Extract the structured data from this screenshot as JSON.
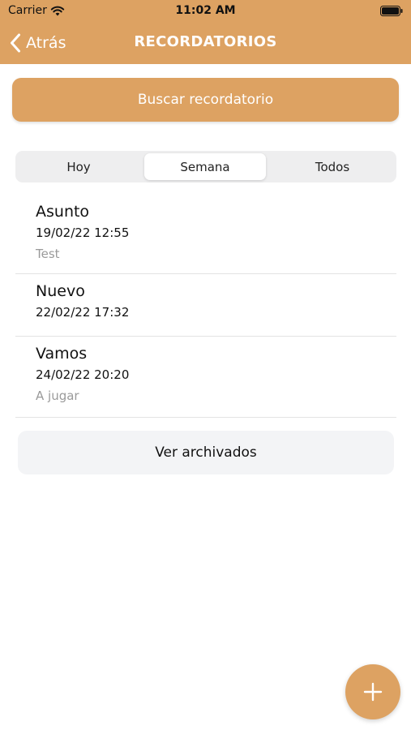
{
  "status_bar": {
    "carrier": "Carrier",
    "time": "11:02 AM",
    "icons": [
      "wifi-icon",
      "battery-icon"
    ]
  },
  "nav": {
    "back_label": "Atrás",
    "title": "RECORDATORIOS"
  },
  "search": {
    "label": "Buscar recordatorio"
  },
  "segments": {
    "items": [
      "Hoy",
      "Semana",
      "Todos"
    ],
    "selected": "Semana"
  },
  "reminders": [
    {
      "title": "Asunto",
      "datetime": "19/02/22 12:55",
      "note": "Test"
    },
    {
      "title": "Nuevo",
      "datetime": "22/02/22 17:32",
      "note": ""
    },
    {
      "title": "Vamos",
      "datetime": "24/02/22 20:20",
      "note": "A jugar"
    }
  ],
  "archive": {
    "label": "Ver archivados"
  },
  "fab": {
    "icon": "plus-icon"
  },
  "colors": {
    "accent": "#dda262",
    "secondary_text": "#9a9a9a",
    "archive_background": "#f3f4f6"
  }
}
